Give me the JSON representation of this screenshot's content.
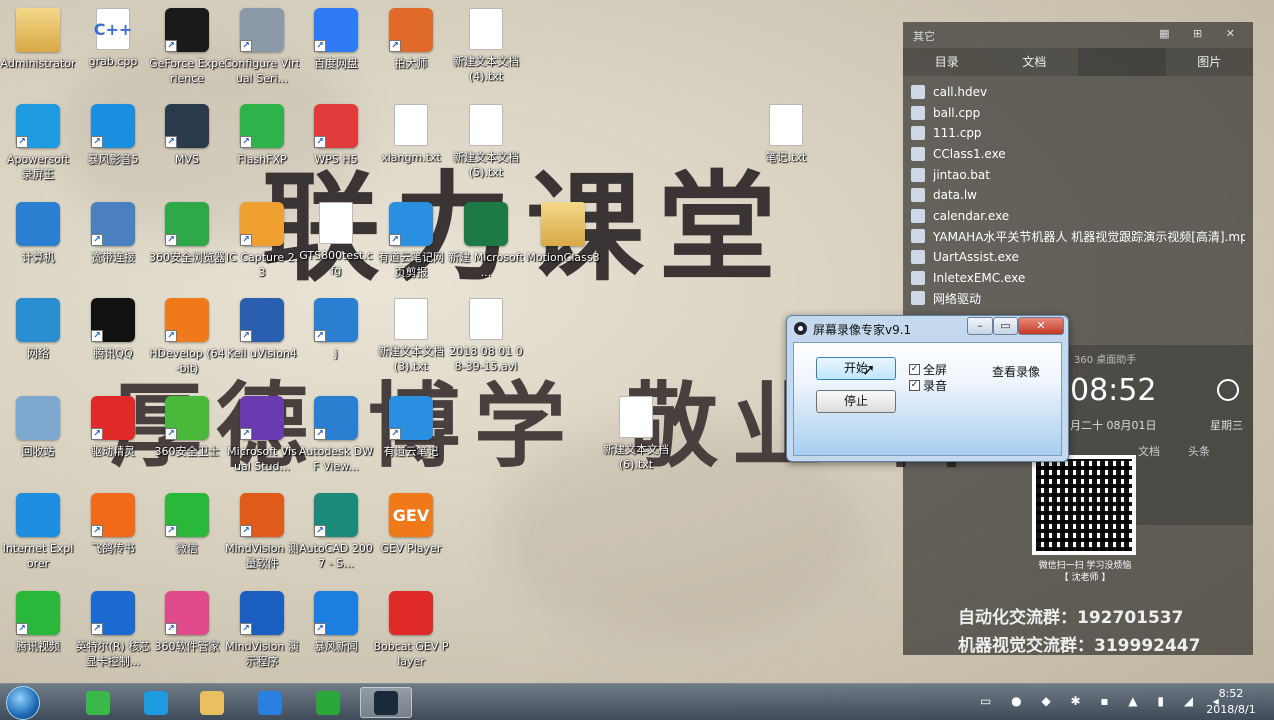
{
  "wallpaper": {
    "title": "联力课堂",
    "motto": "厚德 博学 敬业 群"
  },
  "desktop_icons": [
    {
      "label": "Administrator",
      "icon": "user-folder-icon",
      "color": "#d7a84a",
      "shortcut": false
    },
    {
      "label": "grab.cpp",
      "icon": "cpp-file-icon",
      "color": "#ffffff",
      "glyph": "C++",
      "shortcut": false
    },
    {
      "label": "GeForce Experience",
      "icon": "geforce-icon",
      "color": "#1a1a1a",
      "shortcut": true
    },
    {
      "label": "Configure Virtual Seri...",
      "icon": "serial-port-icon",
      "color": "#8a9aa8",
      "shortcut": true
    },
    {
      "label": "百度网盘",
      "icon": "baidu-netdisk-icon",
      "color": "#2f7bf6",
      "shortcut": true
    },
    {
      "label": "拍大师",
      "icon": "paidashi-icon",
      "color": "#e06a2a",
      "shortcut": true
    },
    {
      "label": "新建文本文档 (4).txt",
      "icon": "text-file-icon",
      "color": "#ffffff",
      "shortcut": false
    },
    {
      "label": "Apowersoft 录屏王",
      "icon": "apowersoft-icon",
      "color": "#1e9be0",
      "shortcut": true
    },
    {
      "label": "暴风影音5",
      "icon": "baofeng-icon",
      "color": "#1a8fe0",
      "shortcut": true
    },
    {
      "label": "MVS",
      "icon": "mvs-icon",
      "color": "#2a3a4a",
      "shortcut": true
    },
    {
      "label": "FlashFXP",
      "icon": "flashfxp-icon",
      "color": "#2db34a",
      "shortcut": true
    },
    {
      "label": "WPS H5",
      "icon": "wps-icon",
      "color": "#e03a3a",
      "shortcut": true
    },
    {
      "label": "xiangm.txt",
      "icon": "text-file-icon",
      "color": "#ffffff",
      "shortcut": false
    },
    {
      "label": "新建文本文档 (5).txt",
      "icon": "text-file-icon",
      "color": "#ffffff",
      "shortcut": false
    },
    {
      "label": "笔记.txt",
      "icon": "text-file-icon",
      "color": "#ffffff",
      "shortcut": false
    },
    {
      "label": "计算机",
      "icon": "computer-icon",
      "color": "#2a7fd0",
      "shortcut": false
    },
    {
      "label": "宽带连接",
      "icon": "network-connection-icon",
      "color": "#4a7fc0",
      "shortcut": true
    },
    {
      "label": "360安全浏览器",
      "icon": "360-browser-icon",
      "color": "#2fa84a",
      "shortcut": true
    },
    {
      "label": "IC Capture 2.3",
      "icon": "ic-capture-icon",
      "color": "#f0a030",
      "shortcut": true
    },
    {
      "label": "GTS800test.cfg",
      "icon": "cfg-file-icon",
      "color": "#ffffff",
      "shortcut": false
    },
    {
      "label": "有道云笔记网页剪报",
      "icon": "youdao-clip-icon",
      "color": "#2a8fe0",
      "shortcut": true
    },
    {
      "label": "新建 Microsoft ...",
      "icon": "excel-icon",
      "color": "#1e7a44",
      "shortcut": false
    },
    {
      "label": "MotionClass3",
      "icon": "folder-icon",
      "color": "#e0b85a",
      "shortcut": false
    },
    {
      "label": "网络",
      "icon": "network-icon",
      "color": "#2a8fd0",
      "shortcut": false
    },
    {
      "label": "腾讯QQ",
      "icon": "qq-icon",
      "color": "#111111",
      "shortcut": true
    },
    {
      "label": "HDevelop (64-bit)",
      "icon": "hdevelop-icon",
      "color": "#f07a1a",
      "shortcut": true
    },
    {
      "label": "Keil uVision4",
      "icon": "keil-icon",
      "color": "#2a5fb0",
      "shortcut": true
    },
    {
      "label": "j",
      "icon": "j-app-icon",
      "color": "#2a7fd0",
      "shortcut": true
    },
    {
      "label": "新建文本文档 (3).txt",
      "icon": "text-file-icon",
      "color": "#ffffff",
      "shortcut": false
    },
    {
      "label": "2018 08 01 08-39-15.avi",
      "icon": "video-file-icon",
      "color": "#8a7a6a",
      "shortcut": false
    },
    {
      "label": "回收站",
      "icon": "recycle-bin-icon",
      "color": "#7fa8d0",
      "shortcut": false
    },
    {
      "label": "驱动精灵",
      "icon": "driver-genius-icon",
      "color": "#e02a2a",
      "shortcut": true
    },
    {
      "label": "360安全卫士",
      "icon": "360-security-icon",
      "color": "#4ab83a",
      "shortcut": true
    },
    {
      "label": "Microsoft Visual Stud...",
      "icon": "visual-studio-icon",
      "color": "#6a3ab0",
      "shortcut": true
    },
    {
      "label": "Autodesk DWF View...",
      "icon": "autodesk-icon",
      "color": "#2a7fd0",
      "shortcut": true
    },
    {
      "label": "有道云笔记",
      "icon": "youdao-note-icon",
      "color": "#2a8fe0",
      "shortcut": true
    },
    {
      "label": "新建文本文档 (6).txt",
      "icon": "text-file-icon",
      "color": "#ffffff",
      "shortcut": false
    },
    {
      "label": "Internet Explorer",
      "icon": "ie-icon",
      "color": "#1e8fe0",
      "shortcut": false
    },
    {
      "label": "飞鸽传书",
      "icon": "feige-icon",
      "color": "#f06a1a",
      "shortcut": true
    },
    {
      "label": "微信",
      "icon": "wechat-icon",
      "color": "#2ab83a",
      "shortcut": true
    },
    {
      "label": "MindVision 测量软件",
      "icon": "mindvision-measure-icon",
      "color": "#e05a1a",
      "shortcut": true
    },
    {
      "label": "AutoCAD 2007 - S...",
      "icon": "autocad-icon",
      "color": "#1a8a7a",
      "shortcut": true
    },
    {
      "label": "GEV Player",
      "icon": "gev-player-icon",
      "color": "#f07a1a",
      "glyph": "GEV",
      "shortcut": false
    },
    {
      "label": "腾讯视频",
      "icon": "tencent-video-icon",
      "color": "#2ab83a",
      "shortcut": true
    },
    {
      "label": "英特尔(R) 核芯显卡控制...",
      "icon": "intel-graphics-icon",
      "color": "#1a6ad0",
      "shortcut": true
    },
    {
      "label": "360软件管家",
      "icon": "360-software-icon",
      "color": "#e04a8a",
      "shortcut": true
    },
    {
      "label": "MindVision 演示程序",
      "icon": "mindvision-demo-icon",
      "color": "#1a5fc0",
      "shortcut": true
    },
    {
      "label": "暴风新闻",
      "icon": "baofeng-news-icon",
      "color": "#1a7fe0",
      "shortcut": true
    },
    {
      "label": "Bobcat GEV Player",
      "icon": "bobcat-icon",
      "color": "#e02a2a",
      "shortcut": false
    }
  ],
  "side_panel": {
    "title": "其它",
    "tabs": [
      "目录",
      "文档",
      "",
      "图片"
    ],
    "active_tab_index": 2,
    "files": [
      "call.hdev",
      "ball.cpp",
      "111.cpp",
      "CClass1.exe",
      "jintao.bat",
      "data.lw",
      "calendar.exe",
      "YAMAHA水平关节机器人 机器视觉跟踪演示视频[高清].mp4",
      "UartAssist.exe",
      "InletexEMC.exe",
      "网络驱动"
    ]
  },
  "calendar_widget": {
    "header": "360 桌面助手",
    "time": "08:52",
    "date": "月二十   08月01日",
    "weekday": "星期三",
    "doc_label": "文档",
    "other_label": "头条"
  },
  "qr_caption": {
    "line1": "微信扫一扫 学习没烦恼",
    "line2": "【 沈老师 】"
  },
  "groups": {
    "automation": "自动化交流群：192701537",
    "vision": "机器视觉交流群：319992447"
  },
  "recorder": {
    "title": "屏幕录像专家v9.1",
    "start_label": "开始",
    "stop_label": "停止",
    "fullscreen_label": "全屏",
    "audio_label": "录音",
    "view_label": "查看录像",
    "fullscreen_checked": true,
    "audio_checked": true
  },
  "taskbar": {
    "items": [
      {
        "icon": "360-browser-icon",
        "color": "#3ab84a",
        "active": false
      },
      {
        "icon": "apowersoft-icon",
        "color": "#1e9be0",
        "active": false
      },
      {
        "icon": "file-explorer-icon",
        "color": "#e8c060",
        "active": false
      },
      {
        "icon": "wps-writer-icon",
        "color": "#2a7fe0",
        "active": false
      },
      {
        "icon": "app-green-icon",
        "color": "#2aa83a",
        "active": false
      },
      {
        "icon": "screen-recorder-icon",
        "color": "#1a2a3a",
        "active": true
      }
    ],
    "time": "8:52",
    "date": "2018/8/1"
  }
}
